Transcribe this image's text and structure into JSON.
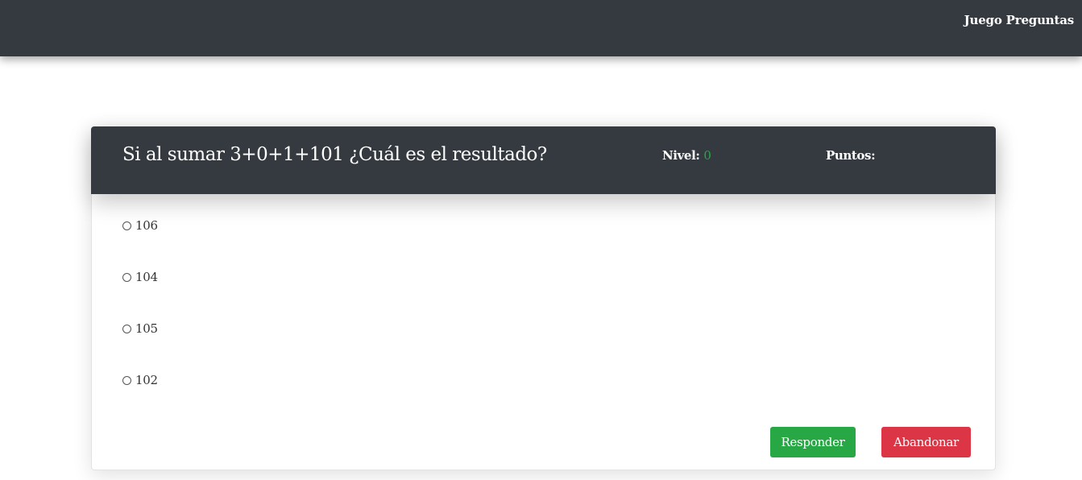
{
  "navbar": {
    "brand": "Juego Preguntas"
  },
  "quiz": {
    "question": "Si al sumar 3+0+1+101 ¿Cuál es el resultado?",
    "level_label": "Nivel:",
    "level_value": "0",
    "points_label": "Puntos:",
    "points_value": "",
    "options": [
      {
        "label": "106",
        "selected": false
      },
      {
        "label": "104",
        "selected": false
      },
      {
        "label": "105",
        "selected": false
      },
      {
        "label": "102",
        "selected": false
      }
    ],
    "answer_button": "Responder",
    "quit_button": "Abandonar"
  },
  "colors": {
    "dark": "#343a40",
    "success": "#28a745",
    "danger": "#dc3545"
  }
}
